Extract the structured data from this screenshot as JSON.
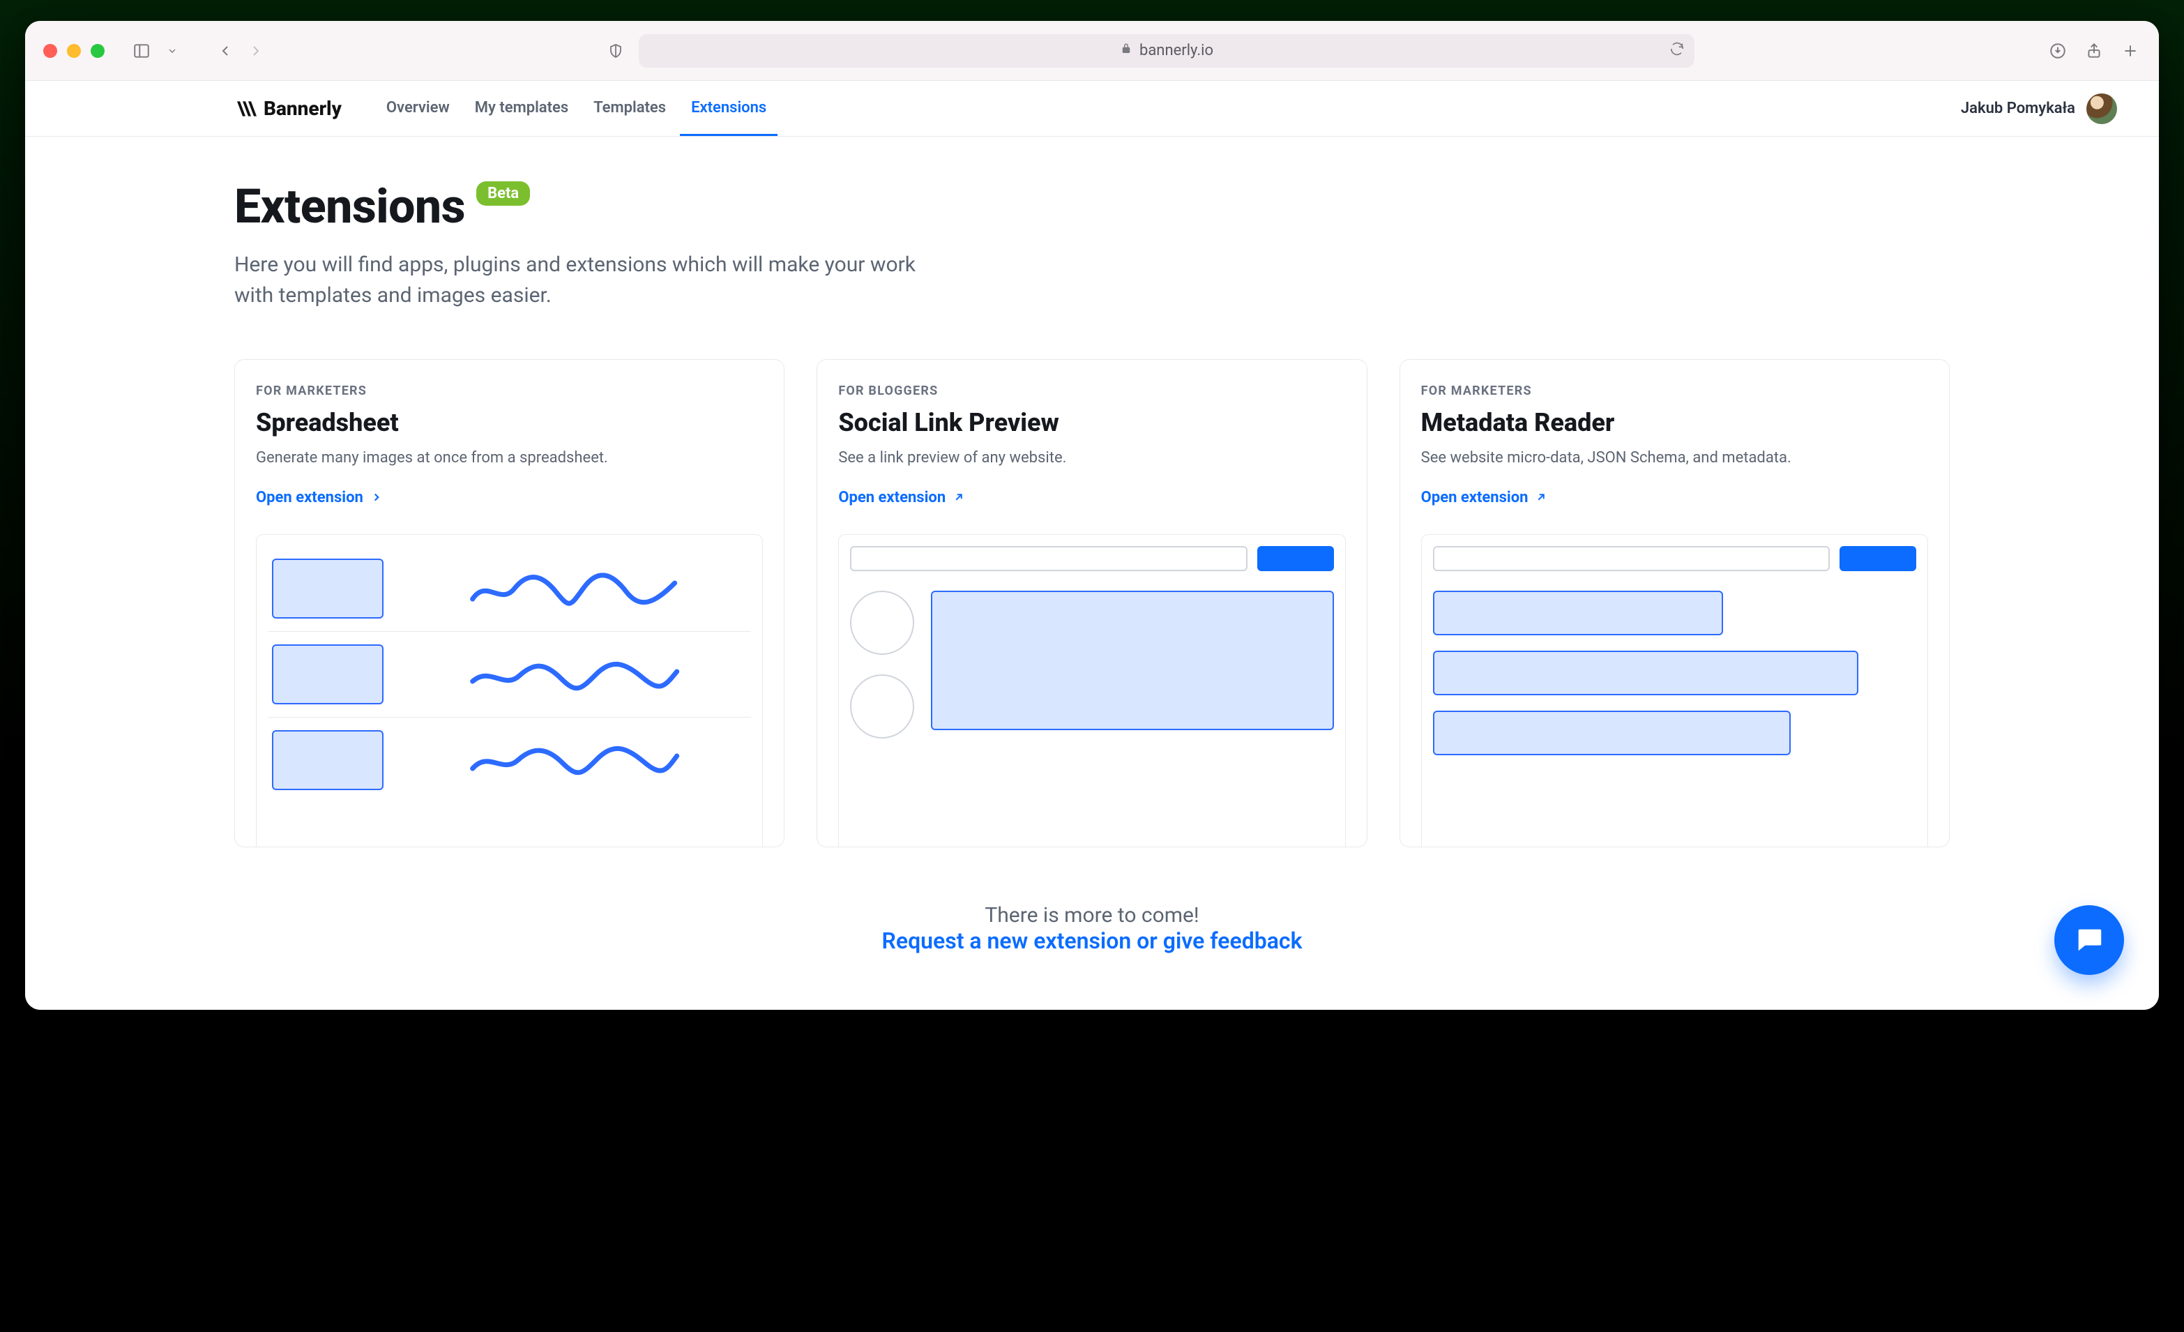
{
  "browser": {
    "url_display": "bannerly.io"
  },
  "nav": {
    "brand": "Bannerly",
    "links": [
      "Overview",
      "My templates",
      "Templates",
      "Extensions"
    ],
    "active_index": 3,
    "user_name": "Jakub Pomykała"
  },
  "page": {
    "title": "Extensions",
    "badge": "Beta",
    "subtitle": "Here you will find apps, plugins and extensions which will make your work with templates and images easier."
  },
  "cards": [
    {
      "eyebrow": "FOR MARKETERS",
      "title": "Spreadsheet",
      "desc": "Generate many images at once from a spreadsheet.",
      "cta": "Open extension",
      "cta_icon": "chevron"
    },
    {
      "eyebrow": "FOR BLOGGERS",
      "title": "Social Link Preview",
      "desc": "See a link preview of any website.",
      "cta": "Open extension",
      "cta_icon": "external"
    },
    {
      "eyebrow": "FOR MARKETERS",
      "title": "Metadata Reader",
      "desc": "See website micro-data, JSON Schema, and metadata.",
      "cta": "Open extension",
      "cta_icon": "external"
    }
  ],
  "footer": {
    "line1": "There is more to come!",
    "line2": "Request a new extension or give feedback"
  },
  "colors": {
    "accent": "#0b6cff",
    "badge": "#7bbf2e"
  }
}
